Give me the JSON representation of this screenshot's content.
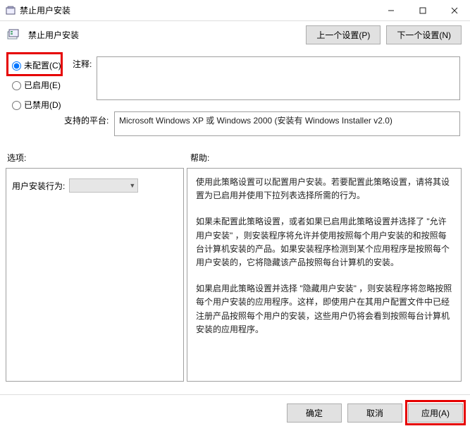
{
  "window": {
    "title": "禁止用户安装"
  },
  "header": {
    "title": "禁止用户安装",
    "prev": "上一个设置(P)",
    "next": "下一个设置(N)"
  },
  "radios": {
    "not_configured": "未配置(C)",
    "enabled": "已启用(E)",
    "disabled": "已禁用(D)"
  },
  "labels": {
    "comment": "注释:",
    "platform": "支持的平台:",
    "options": "选项:",
    "help": "帮助:"
  },
  "platform_text": "Microsoft Windows XP 或 Windows 2000 (安装有 Windows Installer v2.0)",
  "options_panel": {
    "behavior_label": "用户安装行为:"
  },
  "help": {
    "p1": "使用此策略设置可以配置用户安装。若要配置此策略设置，请将其设置为已启用并使用下拉列表选择所需的行为。",
    "p2": "如果未配置此策略设置，或者如果已启用此策略设置并选择了 \"允许用户安装\" ，则安装程序将允许并使用按照每个用户安装的和按照每台计算机安装的产品。如果安装程序检测到某个应用程序是按照每个用户安装的，它将隐藏该产品按照每台计算机的安装。",
    "p3": "如果启用此策略设置并选择 \"隐藏用户安装\" ，则安装程序将忽略按照每个用户安装的应用程序。这样，即使用户在其用户配置文件中已经注册产品按照每个用户的安装，这些用户仍将会看到按照每台计算机安装的应用程序。"
  },
  "footer": {
    "ok": "确定",
    "cancel": "取消",
    "apply": "应用(A)"
  }
}
